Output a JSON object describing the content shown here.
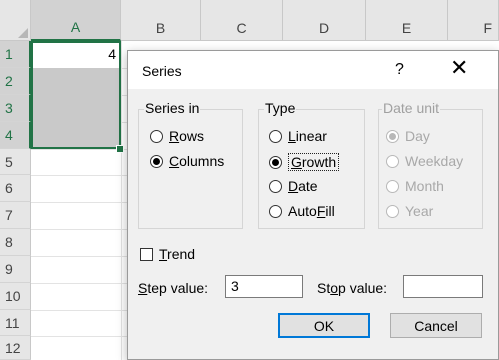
{
  "spreadsheet": {
    "columns": [
      "A",
      "B",
      "C",
      "D",
      "E",
      "F"
    ],
    "rows": [
      "1",
      "2",
      "3",
      "4",
      "5",
      "6",
      "7",
      "8",
      "9",
      "10",
      "11",
      "12"
    ],
    "cell_a1": "4"
  },
  "dialog": {
    "title": "Series",
    "help": "?",
    "close": "✕",
    "series_in": {
      "label": "Series in",
      "options": [
        {
          "pre": "",
          "key": "R",
          "post": "ows",
          "selected": false
        },
        {
          "pre": "",
          "key": "C",
          "post": "olumns",
          "selected": true
        }
      ]
    },
    "type": {
      "label": "Type",
      "options": [
        {
          "pre": "",
          "key": "L",
          "post": "inear",
          "selected": false
        },
        {
          "pre": "",
          "key": "G",
          "post": "rowth",
          "selected": true
        },
        {
          "pre": "",
          "key": "D",
          "post": "ate",
          "selected": false
        },
        {
          "pre": "Auto",
          "key": "F",
          "post": "ill",
          "selected": false
        }
      ]
    },
    "date_unit": {
      "label": "Date unit",
      "options": [
        "Day",
        "Weekday",
        "Month",
        "Year"
      ],
      "selected": "Day"
    },
    "trend": {
      "pre": "",
      "key": "T",
      "post": "rend",
      "checked": false
    },
    "step_value": {
      "pre": "",
      "key": "S",
      "post": "tep value:",
      "value": "3"
    },
    "stop_value": {
      "pre": "St",
      "key": "o",
      "post": "p value:",
      "value": ""
    },
    "ok_label": "OK",
    "cancel_label": "Cancel"
  },
  "colors": {
    "accent": "#217346",
    "focus": "#0078d7",
    "dialog_bg": "#f0f0f0"
  }
}
